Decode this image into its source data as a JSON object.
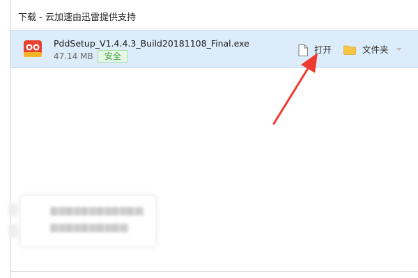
{
  "window": {
    "title": "下载 - 云加速由迅雷提供支持"
  },
  "download": {
    "file_name": "PddSetup_V1.4.4.3_Build20181108_Final.exe",
    "file_size": "47.14 MB",
    "safety_badge": "安全",
    "icon": "app-icon",
    "actions": {
      "open_label": "打开",
      "open_icon": "document-icon",
      "folder_label": "文件夹",
      "folder_icon": "folder-icon",
      "more_icon": "caret-down-icon"
    }
  },
  "annotation": {
    "arrow_color": "#ee3b2f",
    "points_to": "open-button"
  },
  "colors": {
    "row_highlight": "#dcecfb",
    "safe_green": "#3aa23a",
    "folder_yellow": "#f5c642"
  }
}
